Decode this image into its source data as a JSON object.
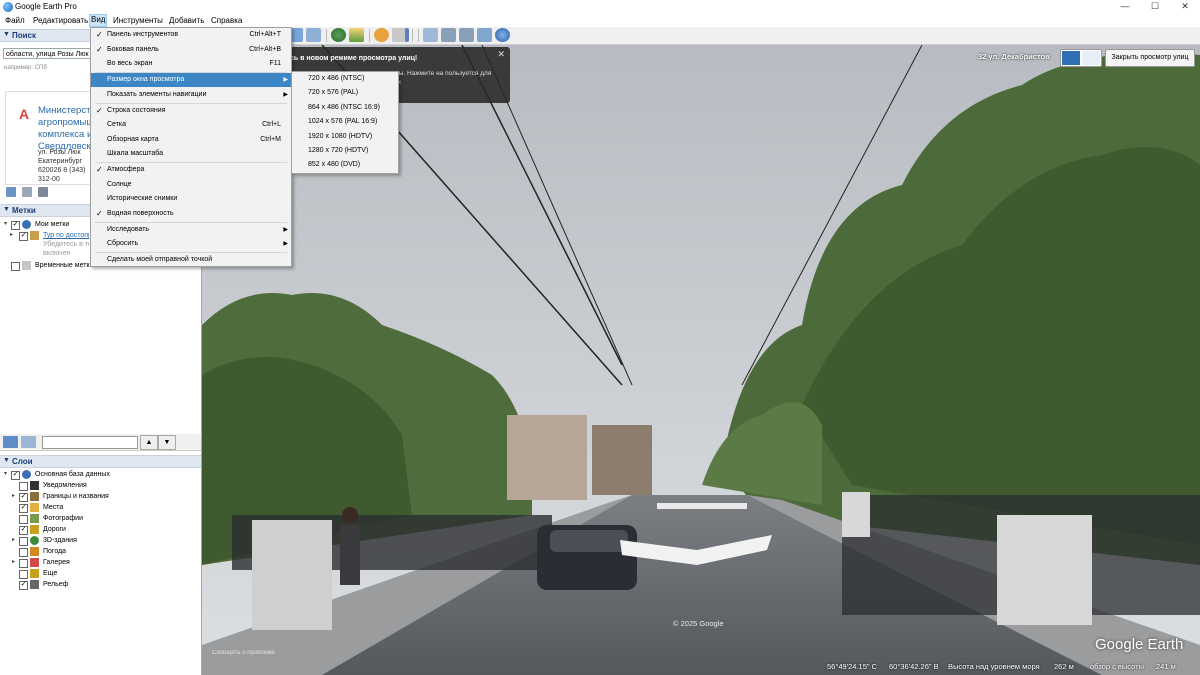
{
  "window": {
    "title": "Google Earth Pro",
    "minimize": "—",
    "maximize": "☐",
    "close": "✕"
  },
  "menubar": [
    "Файл",
    "Редактировать",
    "Вид",
    "Инструменты",
    "Добавить",
    "Справка"
  ],
  "sidebar": {
    "search": {
      "header": "Поиск",
      "value": "области, улица Розы Люк",
      "hint": "например: СПб",
      "result": {
        "marker": "A",
        "title": "Министерство агропромышленного комплекса и Свердловской",
        "address": "ул. Розы Люк Екатеринбург 620026 8 (343) 312-00"
      }
    },
    "places": {
      "header": "Метки",
      "items": [
        {
          "label": "Мои метки",
          "checked": true
        },
        {
          "label": "Тур по достопримечательностям",
          "checked": true
        },
        {
          "label": "Убедитесь в том, что",
          "checked": false
        },
        {
          "label": "включен",
          "checked": false
        },
        {
          "label": "Временные метки",
          "checked": false
        }
      ]
    },
    "layers": {
      "header": "Слои",
      "items": [
        {
          "label": "Основная база данных",
          "checked": true,
          "icon": "globe-icon"
        },
        {
          "label": "Уведомления",
          "checked": false,
          "icon": "notification-icon"
        },
        {
          "label": "Границы и названия",
          "checked": true,
          "icon": "borders-icon"
        },
        {
          "label": "Места",
          "checked": true,
          "icon": "places-icon"
        },
        {
          "label": "Фотографии",
          "checked": false,
          "icon": "photo-icon"
        },
        {
          "label": "Дороги",
          "checked": true,
          "icon": "roads-icon"
        },
        {
          "label": "3D-здания",
          "checked": false,
          "icon": "buildings-icon"
        },
        {
          "label": "Погода",
          "checked": false,
          "icon": "weather-icon"
        },
        {
          "label": "Галерея",
          "checked": false,
          "icon": "gallery-icon"
        },
        {
          "label": "Еще",
          "checked": false,
          "icon": "more-icon"
        },
        {
          "label": "Рельеф",
          "checked": true,
          "icon": "terrain-icon"
        }
      ]
    }
  },
  "view_menu": [
    {
      "label": "Панель инструментов",
      "shortcut": "Ctrl+Alt+T",
      "checked": true
    },
    {
      "label": "Боковая панель",
      "shortcut": "Ctrl+Alt+B",
      "checked": true
    },
    {
      "label": "Во весь экран",
      "shortcut": "F11",
      "checked": false
    },
    {
      "label": "Размер окна просмотра",
      "shortcut": "",
      "checked": false,
      "submenu": true,
      "highlighted": true
    },
    {
      "label": "Показать элементы навигации",
      "shortcut": "",
      "checked": false,
      "submenu": true
    },
    {
      "label": "Строка состояния",
      "shortcut": "",
      "checked": true
    },
    {
      "label": "Сетка",
      "shortcut": "Ctrl+L",
      "checked": false
    },
    {
      "label": "Обзорная карта",
      "shortcut": "Ctrl+M",
      "checked": false
    },
    {
      "label": "Шкала масштаба",
      "shortcut": "",
      "checked": false
    },
    {
      "label": "Атмосфера",
      "shortcut": "",
      "checked": true
    },
    {
      "label": "Солнце",
      "shortcut": "",
      "checked": false
    },
    {
      "label": "Исторические снимки",
      "shortcut": "",
      "checked": false
    },
    {
      "label": "Водная поверхность",
      "shortcut": "",
      "checked": true
    },
    {
      "label": "Исследовать",
      "shortcut": "",
      "checked": false,
      "submenu": true
    },
    {
      "label": "Сбросить",
      "shortcut": "",
      "checked": false,
      "submenu": true
    },
    {
      "label": "Сделать моей отправной точкой",
      "shortcut": "",
      "checked": false
    }
  ],
  "view_size_submenu": [
    "720 x 486 (NTSC)",
    "720 x 576 (PAL)",
    "864 x 486 (NTSC 16:9)",
    "1024 x 576 (PAL 16:9)",
    "1920 x 1080 (HDTV)",
    "1280 x 720 (HDTV)",
    "852 x 480 (DVD)"
  ],
  "tooltip": {
    "title": "сь в новом режиме просмотра улиц!",
    "body": "клавиатуры. Нажмите на пользуется для перехода к"
  },
  "street_view": {
    "street": "32 ул. Декабристов",
    "close_label": "Закрыть просмотр улиц",
    "copyright": "© 2025 Google",
    "report": "Сообщить о проблеме",
    "logo": "Google Earth"
  },
  "status_bar": {
    "lat": "56°49'24.15\" С",
    "lon": "60°36'42.26\" В",
    "elev_label": "Высота над уровнем моря",
    "elev_value": "262 м",
    "eye_label": "обзор с высоты",
    "eye_value": "241 м"
  },
  "colors": {
    "accent": "#3c86c6",
    "header_bg": "#dfe7f1",
    "link": "#2a6aa8"
  }
}
